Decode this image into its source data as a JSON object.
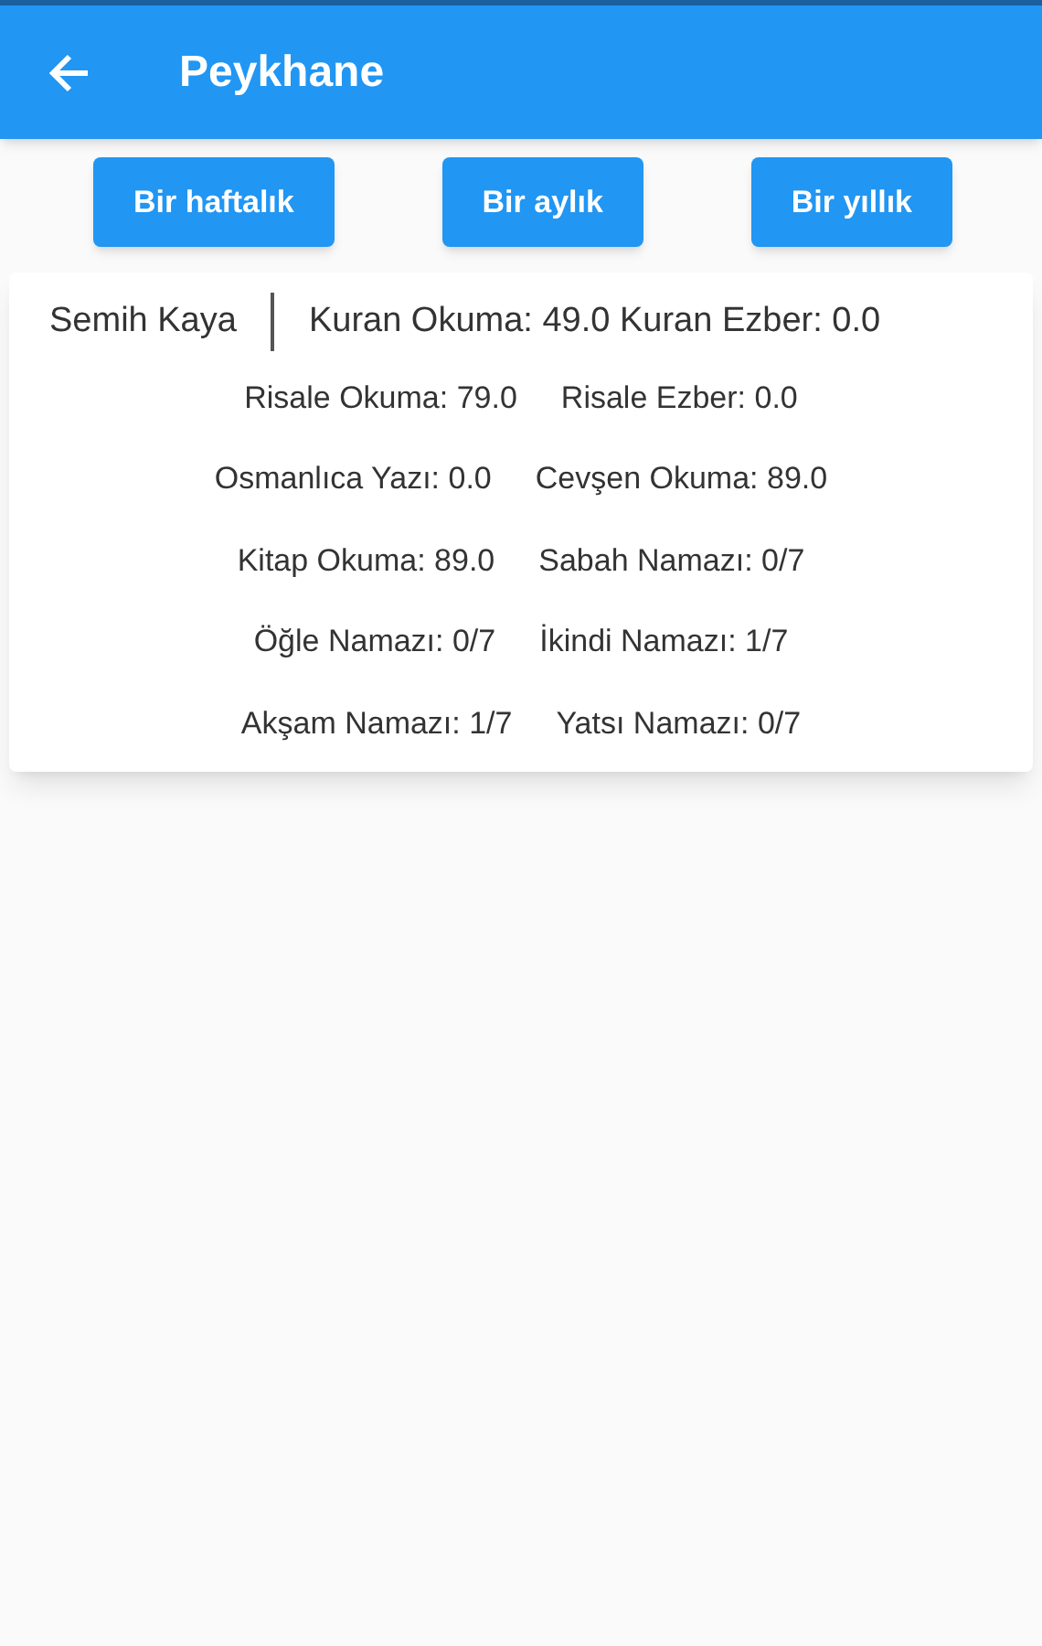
{
  "app_bar": {
    "title": "Peykhane"
  },
  "buttons": [
    "Bir haftalık",
    "Bir aylık",
    "Bir yıllık"
  ],
  "card": {
    "name": "Semih Kaya",
    "summary": "Kuran Okuma: 49.0 Kuran Ezber: 0.0",
    "rows": [
      [
        "Risale Okuma: 79.0",
        "Risale Ezber: 0.0"
      ],
      [
        "Osmanlıca Yazı: 0.0",
        "Cevşen Okuma: 89.0"
      ],
      [
        "Kitap Okuma: 89.0",
        "Sabah Namazı: 0/7"
      ],
      [
        "Öğle Namazı: 0/7",
        "İkindi Namazı: 1/7"
      ],
      [
        "Akşam Namazı: 1/7",
        "Yatsı Namazı: 0/7"
      ]
    ]
  }
}
